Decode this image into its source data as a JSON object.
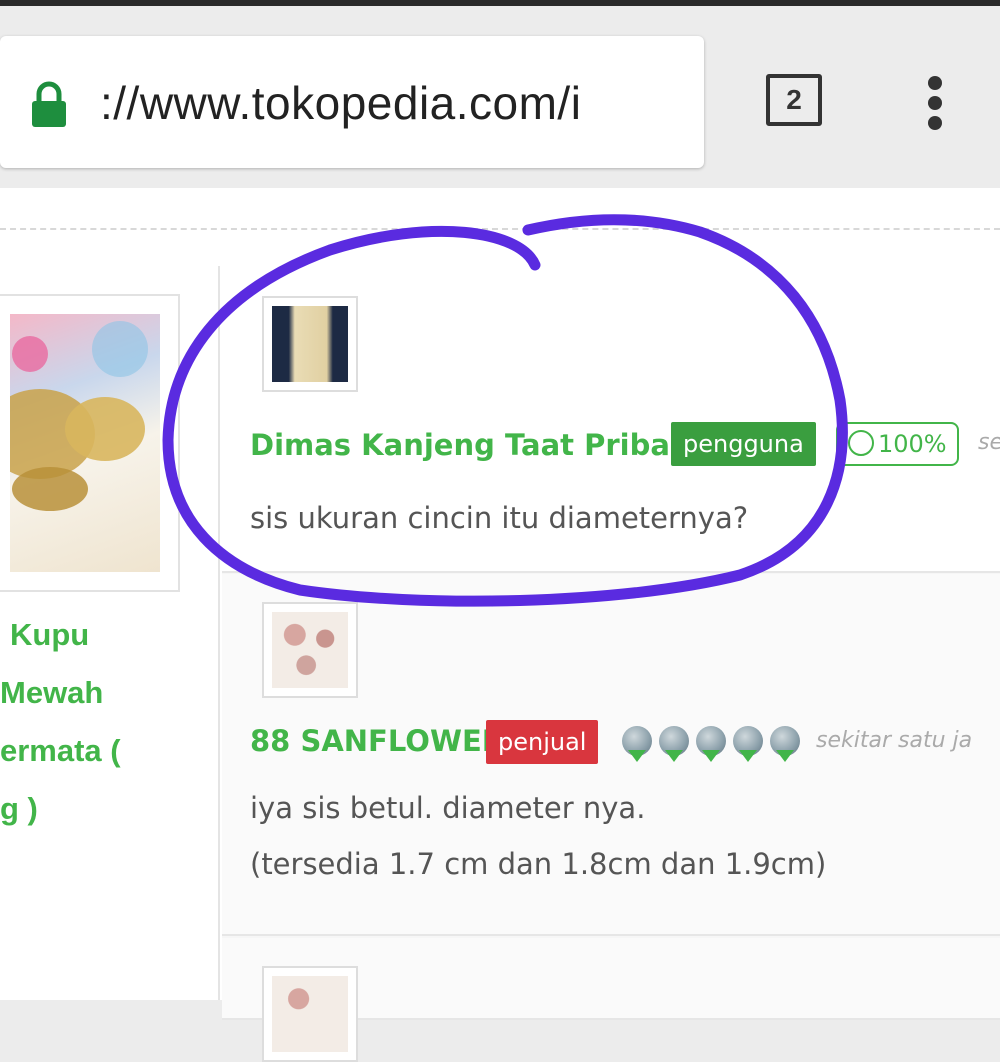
{
  "browser": {
    "url": "://www.tokopedia.com/i",
    "tab_count": "2"
  },
  "product": {
    "name_lines": [
      "Kupu",
      "Mewah",
      "ermata (",
      "g )"
    ]
  },
  "comments": [
    {
      "username": "Dimas Kanjeng Taat Pribadi",
      "role": "pengguna",
      "reputation": "100%",
      "time": "se",
      "message": "sis ukuran cincin itu diameternya?"
    },
    {
      "username": "88 SANFLOWER",
      "role": "penjual",
      "medals": 5,
      "time": "sekitar satu ja",
      "message_lines": [
        "iya sis betul. diameter nya.",
        "(tersedia 1.7 cm dan 1.8cm dan 1.9cm)"
      ]
    }
  ],
  "colors": {
    "brand_green": "#42b549",
    "seller_red": "#d9363e",
    "annotation_purple": "#5a2be0"
  }
}
